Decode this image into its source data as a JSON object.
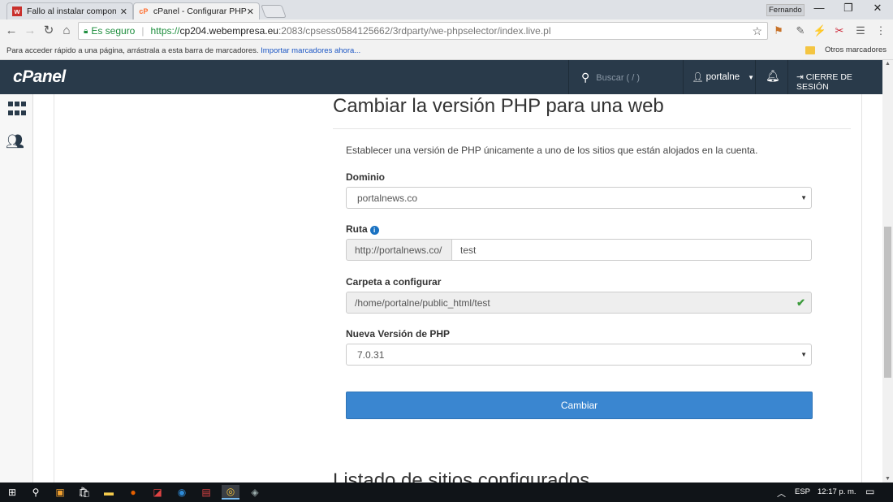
{
  "browser": {
    "tabs": [
      {
        "title": "Fallo al instalar compone",
        "favicon": "wu-favicon",
        "active": false
      },
      {
        "title": "cPanel - Configurar PHP",
        "favicon": "cp-favicon",
        "active": true
      }
    ],
    "profile_name": "Fernando",
    "window_controls": {
      "minimize": "—",
      "restore": "❐",
      "close": "✕"
    },
    "secure_label": "Es seguro",
    "url": {
      "scheme": "https://",
      "host": "cp204.webempresa.eu",
      "rest": ":2083/cpsess0584125662/3rdparty/we-phpselector/index.live.pl"
    },
    "bookmarks_hint": "Para acceder rápido a una página, arrástrala a esta barra de marcadores.",
    "bookmarks_import": "Importar marcadores ahora...",
    "bookmarks_other": "Otros marcadores"
  },
  "cpanel": {
    "logo": "cPanel",
    "search_placeholder": "Buscar ( / )",
    "username": "portalne",
    "logout": "CIERRE DE SESIÓN"
  },
  "page": {
    "title": "Cambiar la versión PHP para una web",
    "description": "Establecer una versión de PHP únicamente a uno de los sitios que están alojados en la cuenta.",
    "domain_label": "Dominio",
    "domain_value": "portalnews.co",
    "path_label": "Ruta",
    "path_prefix": "http://portalnews.co/",
    "path_value": "test",
    "folder_label": "Carpeta a configurar",
    "folder_value": "/home/portalne/public_html/test",
    "version_label": "Nueva Versión de PHP",
    "version_value": "7.0.31",
    "submit_label": "Cambiar",
    "next_section_title": "Listado de sitios configurados"
  },
  "taskbar": {
    "language": "ESP",
    "time": "12:17 p. m."
  },
  "colors": {
    "cpanel_header": "#293a4a",
    "primary_button": "#3a86d0",
    "secure_green": "#1e8e3e"
  }
}
